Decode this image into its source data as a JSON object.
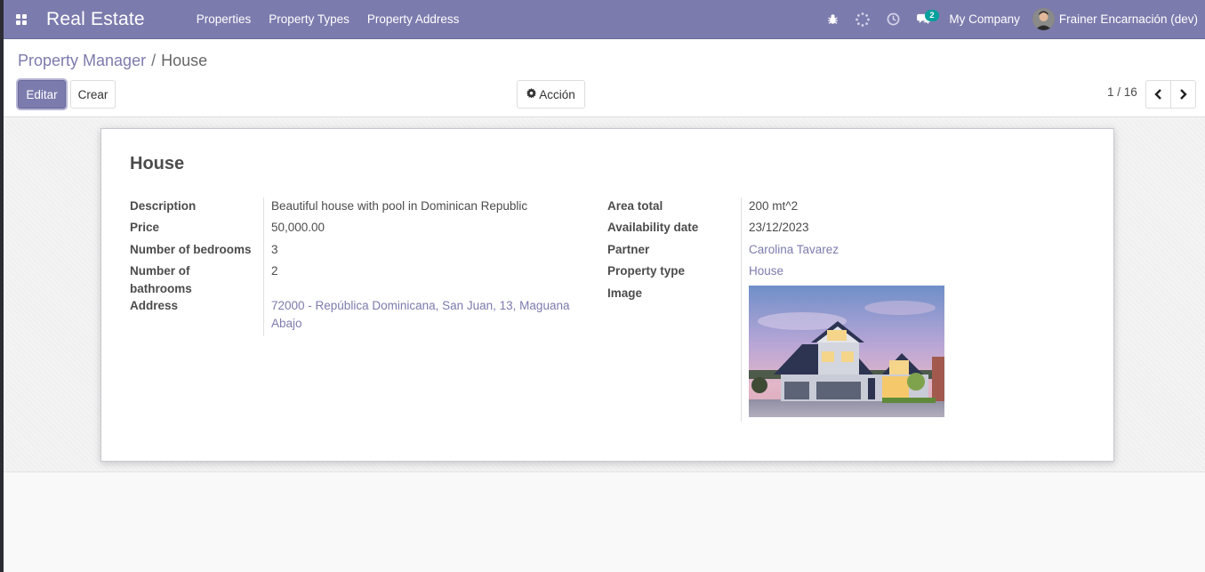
{
  "navbar": {
    "app_name": "Real Estate",
    "menu": [
      {
        "label": "Properties"
      },
      {
        "label": "Property Types"
      },
      {
        "label": "Property Address"
      }
    ],
    "messages_count": "2",
    "company": "My Company",
    "user": "Frainer Encarnación (dev)"
  },
  "breadcrumb": {
    "parent": "Property Manager",
    "separator": "/",
    "current": "House"
  },
  "buttons": {
    "edit": "Editar",
    "create": "Crear",
    "action": "Acción"
  },
  "pager": {
    "value": "1 / 16"
  },
  "record": {
    "title": "House",
    "labels": {
      "description": "Description",
      "price": "Price",
      "bedrooms": "Number of bedrooms",
      "bathrooms": "Number of bathrooms",
      "address": "Address",
      "area": "Area total",
      "availability": "Availability date",
      "partner": "Partner",
      "property_type": "Property type",
      "image": "Image"
    },
    "values": {
      "description": "Beautiful house with pool in Dominican Republic",
      "price": "50,000.00",
      "bedrooms": "3",
      "bathrooms": "2",
      "address": "72000 - República Dominicana, San Juan, 13, Maguana Abajo",
      "area": "200 mt^2",
      "availability": "23/12/2023",
      "partner": "Carolina Tavarez",
      "property_type": "House"
    }
  },
  "colors": {
    "brand": "#7c7bad",
    "badge": "#00a09d"
  }
}
